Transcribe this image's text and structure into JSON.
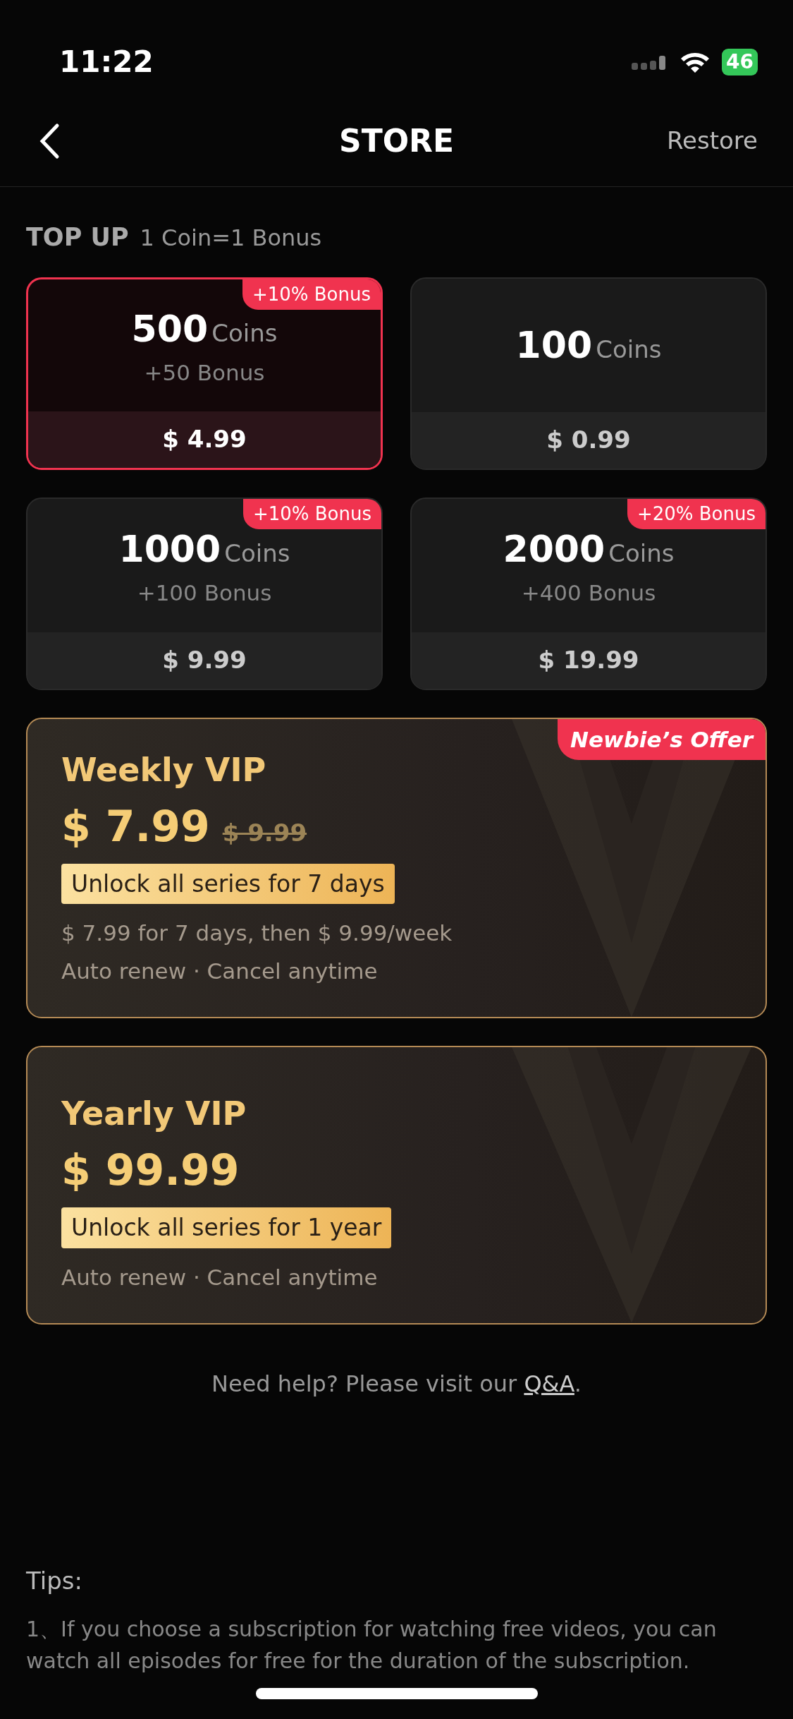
{
  "status_bar": {
    "time": "11:22",
    "battery": "46"
  },
  "header": {
    "title": "STORE",
    "action": "Restore"
  },
  "top_up": {
    "title": "TOP UP",
    "subtitle": "1 Coin=1 Bonus",
    "packages": [
      {
        "amount": "500",
        "unit": "Coins",
        "bonus": "+50 Bonus",
        "price": "$ 4.99",
        "badge": "+10% Bonus",
        "selected": true
      },
      {
        "amount": "100",
        "unit": "Coins",
        "price": "$ 0.99",
        "selected": false
      },
      {
        "amount": "1000",
        "unit": "Coins",
        "bonus": "+100 Bonus",
        "price": "$ 9.99",
        "badge": "+10% Bonus",
        "selected": false
      },
      {
        "amount": "2000",
        "unit": "Coins",
        "bonus": "+400 Bonus",
        "price": "$ 19.99",
        "badge": "+20% Bonus",
        "selected": false
      }
    ]
  },
  "vip_plans": [
    {
      "name": "Weekly VIP",
      "price": "$ 7.99",
      "old_price": "$ 9.99",
      "feature": "Unlock all series for 7 days",
      "terms": [
        "$ 7.99 for 7 days, then $ 9.99/week",
        "Auto renew · Cancel anytime"
      ],
      "badge": "Newbie’s Offer"
    },
    {
      "name": "Yearly VIP",
      "price": "$ 99.99",
      "feature": "Unlock all series for 1 year",
      "terms": [
        "Auto renew · Cancel anytime"
      ]
    }
  ],
  "help": {
    "text": "Need help? Please visit our",
    "link": "Q&A",
    "end": "."
  },
  "tips": {
    "title": "Tips:",
    "items": [
      "1、If you choose a subscription for watching free videos, you can watch all episodes for free for the duration of the subscription."
    ]
  }
}
